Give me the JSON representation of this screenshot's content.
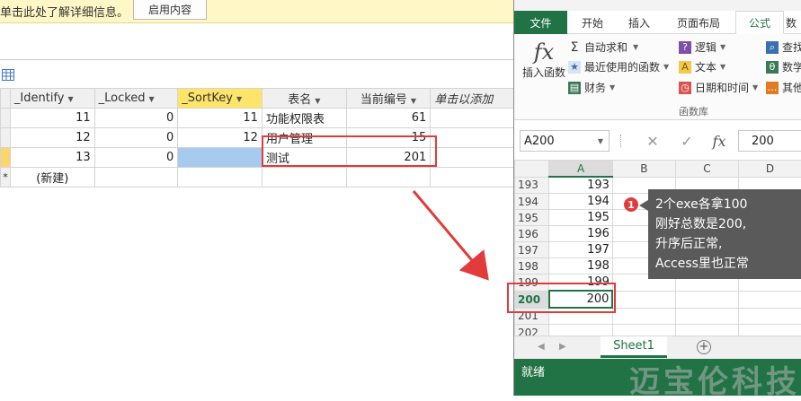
{
  "access": {
    "message_bar": {
      "text": "单击此处了解详细信息。",
      "button": "启用内容"
    },
    "table": {
      "columns": [
        "_Identify",
        "_Locked",
        "_SortKey",
        "表名",
        "当前编号",
        "单击以添加"
      ],
      "rows": [
        {
          "identify": "11",
          "locked": "0",
          "sortkey": "11",
          "name": "功能权限表",
          "current": "61"
        },
        {
          "identify": "12",
          "locked": "0",
          "sortkey": "12",
          "name": "用户管理",
          "current": "15"
        },
        {
          "identify": "13",
          "locked": "0",
          "sortkey": "",
          "name": "测试",
          "current": "201"
        }
      ],
      "new_row_marker": "*",
      "new_row_label": "(新建)"
    }
  },
  "excel": {
    "tabs": [
      "文件",
      "开始",
      "插入",
      "页面布局",
      "公式",
      "数"
    ],
    "active_tab": "公式",
    "ribbon": {
      "insert_function": "插入函数",
      "autosum": "自动求和",
      "recent": "最近使用的函数",
      "financial": "财务",
      "logical": "逻辑",
      "text": "文本",
      "datetime": "日期和时间",
      "lookup": "查找",
      "math": "数学",
      "other": "其他",
      "group_label": "函数库"
    },
    "formula_bar": {
      "name_box": "A200",
      "fx": "fx",
      "value": "200"
    },
    "columns": [
      "A",
      "B",
      "C",
      "D"
    ],
    "rows": [
      {
        "num": "193",
        "a": "193"
      },
      {
        "num": "194",
        "a": "194"
      },
      {
        "num": "195",
        "a": "195"
      },
      {
        "num": "196",
        "a": "196"
      },
      {
        "num": "197",
        "a": "197"
      },
      {
        "num": "198",
        "a": "198"
      },
      {
        "num": "199",
        "a": "199"
      },
      {
        "num": "200",
        "a": "200"
      },
      {
        "num": "201",
        "a": ""
      },
      {
        "num": "202",
        "a": ""
      }
    ],
    "sheet_tab": "Sheet1",
    "add_sheet": "+",
    "status": "就绪"
  },
  "annotation": {
    "badge": "1",
    "lines": [
      "2个exe各拿100",
      "刚好总数是200,",
      "升序后正常,",
      "Access里也正常"
    ]
  },
  "watermark": "迈宝伦科技",
  "colors": {
    "excel_green": "#217346",
    "highlight_red": "#e23b3b",
    "message_bar": "#fff7c5",
    "sortkey_header": "#ffe46a",
    "selected_cell": "#a7cbee",
    "tooltip_bg": "#5a5a5a"
  }
}
